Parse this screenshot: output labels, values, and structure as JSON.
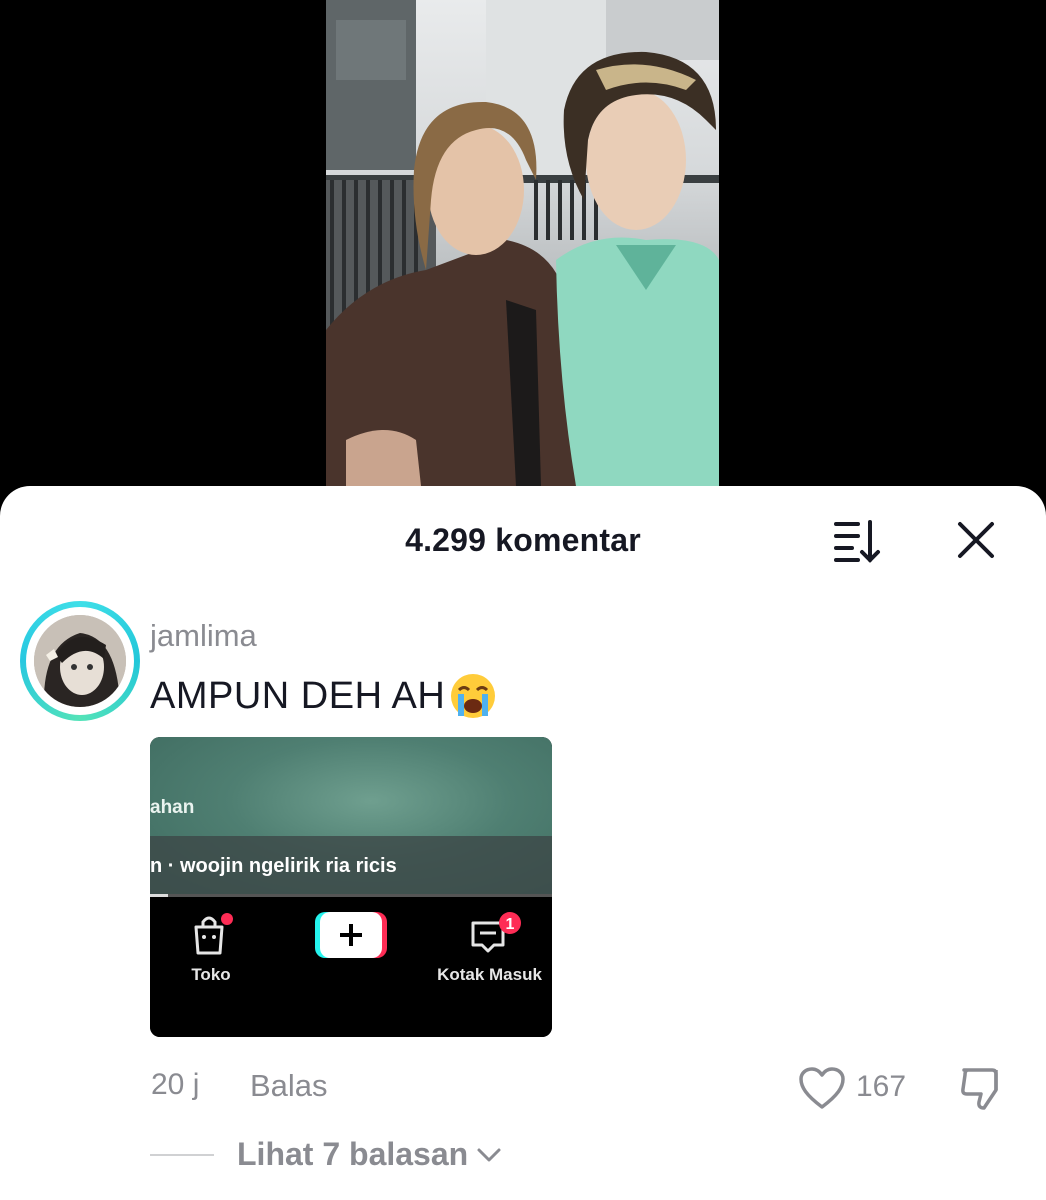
{
  "header": {
    "comment_count_title": "4.299 komentar"
  },
  "icons": {
    "sort": "sort-icon",
    "close": "close-icon",
    "like": "heart-icon",
    "dislike": "thumbs-down-icon"
  },
  "comment": {
    "username": "jamlima",
    "text": "AMPUN DEH AH",
    "emoji": "loudly-crying-face",
    "time": "20 j",
    "reply_label": "Balas",
    "like_count": "167",
    "view_replies": "Lihat 7 balasan",
    "attachment": {
      "label_partial": "ahan",
      "caption": "n · woojin ngelirik ria ricis",
      "nav": {
        "shop": "Toko",
        "inbox": "Kotak Masuk",
        "inbox_badge": "1"
      }
    }
  },
  "colors": {
    "accent_ring": "#3fdfe8",
    "muted_text": "#8a8b91",
    "badge": "#fe2c55"
  }
}
